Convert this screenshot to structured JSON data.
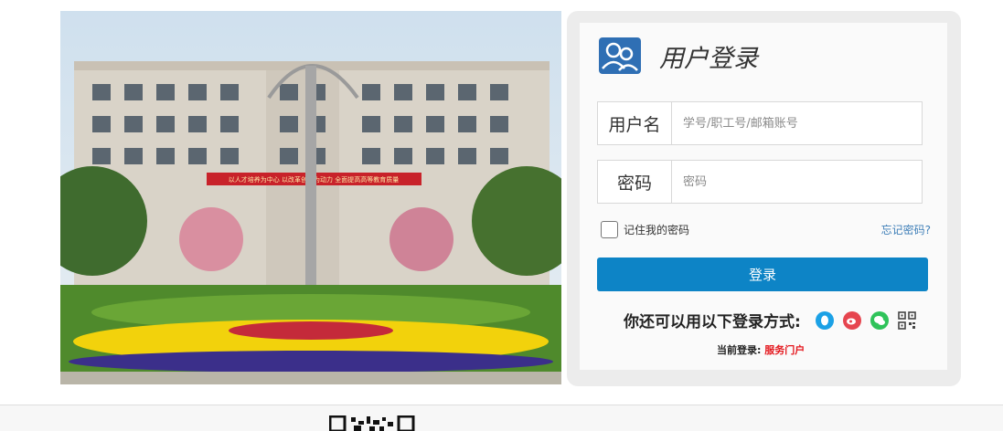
{
  "login": {
    "title": "用户登录",
    "username_label": "用户名",
    "username_placeholder": "学号/职工号/邮箱账号",
    "password_label": "密码",
    "password_placeholder": "密码",
    "remember_label": "记住我的密码",
    "forgot_label": "忘记密码?",
    "submit_label": "登录",
    "alt_login_text": "你还可以用以下登录方式:",
    "alt_login_icons": [
      "qq-icon",
      "weibo-icon",
      "wechat-icon",
      "qrcode-icon"
    ],
    "current_prefix": "当前登录:",
    "current_link": "服务门户"
  },
  "banner_text": "以人才培养为中心 以改革创新为动力 全面提高高等教育质量",
  "colors": {
    "primary_button": "#0d84c6",
    "link": "#3f7fb8",
    "current_link": "#e4161c",
    "panel_border": "#ececec"
  }
}
